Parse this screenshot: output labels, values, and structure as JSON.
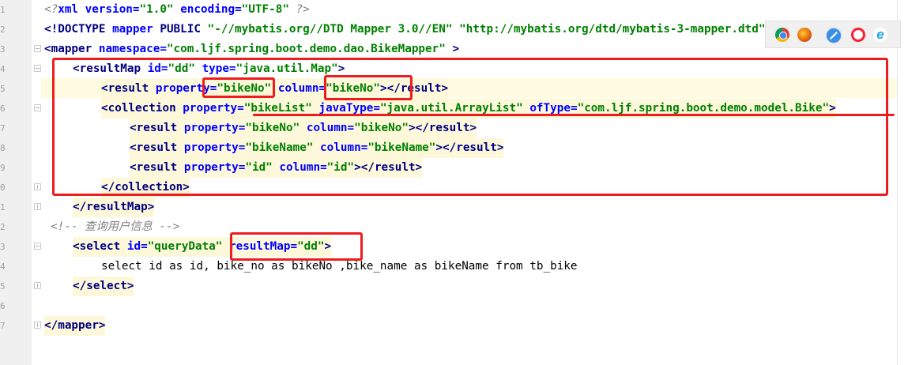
{
  "editor": {
    "lines": [
      {
        "n": "1"
      },
      {
        "n": "2"
      },
      {
        "n": "3"
      },
      {
        "n": "4"
      },
      {
        "n": "5"
      },
      {
        "n": "6"
      },
      {
        "n": "7"
      },
      {
        "n": "8"
      },
      {
        "n": "9"
      },
      {
        "n": "0"
      },
      {
        "n": "1"
      },
      {
        "n": "2"
      },
      {
        "n": "3"
      },
      {
        "n": "4"
      },
      {
        "n": "5"
      },
      {
        "n": "6"
      },
      {
        "n": "7"
      }
    ],
    "code": {
      "l1": [
        "<?",
        "xml ",
        "version",
        "=",
        "\"1.0\"",
        " ",
        "encoding",
        "=",
        "\"UTF-8\"",
        " ?>"
      ],
      "l2": [
        "<!DOCTYPE ",
        "mapper",
        " PUBLIC ",
        "\"-//mybatis.org//DTD Mapper 3.0//EN\"",
        " ",
        "\"http://mybatis.org/dtd/mybatis-3-mapper.dtd\"",
        ">"
      ],
      "l3": [
        "<",
        "mapper",
        " ",
        "namespace",
        "=",
        "\"com.ljf.spring.boot.demo.dao.BikeMapper\"",
        " >"
      ],
      "l4": [
        "<",
        "resultMap",
        " ",
        "id",
        "=",
        "\"dd\"",
        " ",
        "type",
        "=",
        "\"java.util.Map\"",
        ">"
      ],
      "l5": [
        "<",
        "result",
        " ",
        "property",
        "=",
        "\"bikeNo\"",
        " ",
        "column",
        "=",
        "\"bikeNo\"",
        "></",
        "result",
        ">"
      ],
      "l6": [
        "<",
        "collection",
        " ",
        "property",
        "=",
        "\"bikeList\"",
        " ",
        "javaType",
        "=",
        "\"java.util.ArrayList\"",
        " ",
        "ofType",
        "=",
        "\"com.ljf.spring.boot.demo.model.Bike\"",
        ">"
      ],
      "l7": [
        "<",
        "result",
        " ",
        "property",
        "=",
        "\"bikeNo\"",
        " ",
        "column",
        "=",
        "\"bikeNo\"",
        "></",
        "result",
        ">"
      ],
      "l8": [
        "<",
        "result",
        " ",
        "property",
        "=",
        "\"bikeName\"",
        " ",
        "column",
        "=",
        "\"bikeName\"",
        "></",
        "result",
        ">"
      ],
      "l9": [
        "<",
        "result",
        " ",
        "property",
        "=",
        "\"id\"",
        " ",
        "column",
        "=",
        "\"id\"",
        "></",
        "result",
        ">"
      ],
      "l10": [
        "</",
        "collection",
        ">"
      ],
      "l11": [
        "</",
        "resultMap",
        ">"
      ],
      "l12": [
        "<!-- 查询用户信息 -->"
      ],
      "l13": [
        "<",
        "select",
        " ",
        "id",
        "=",
        "\"queryData\"",
        " ",
        "resultMap",
        "=",
        "\"dd\"",
        ">"
      ],
      "l14": [
        "select id as id, bike_no as bikeNo ,bike_name as bikeName from tb_bike"
      ],
      "l15": [
        "</",
        "select",
        ">"
      ],
      "l16": [
        ""
      ],
      "l17": [
        "</",
        "mapper",
        ">"
      ]
    }
  },
  "browser_icons": [
    "chrome-icon",
    "firefox-icon",
    "safari-icon",
    "opera-icon",
    "ie-icon",
    "edge-icon"
  ],
  "colors": {
    "tag": "#000080",
    "attribute": "#0000ff",
    "value": "#008000",
    "comment": "#808080",
    "annotation": "#ee1c1c",
    "current_line": "#fffbe1"
  }
}
